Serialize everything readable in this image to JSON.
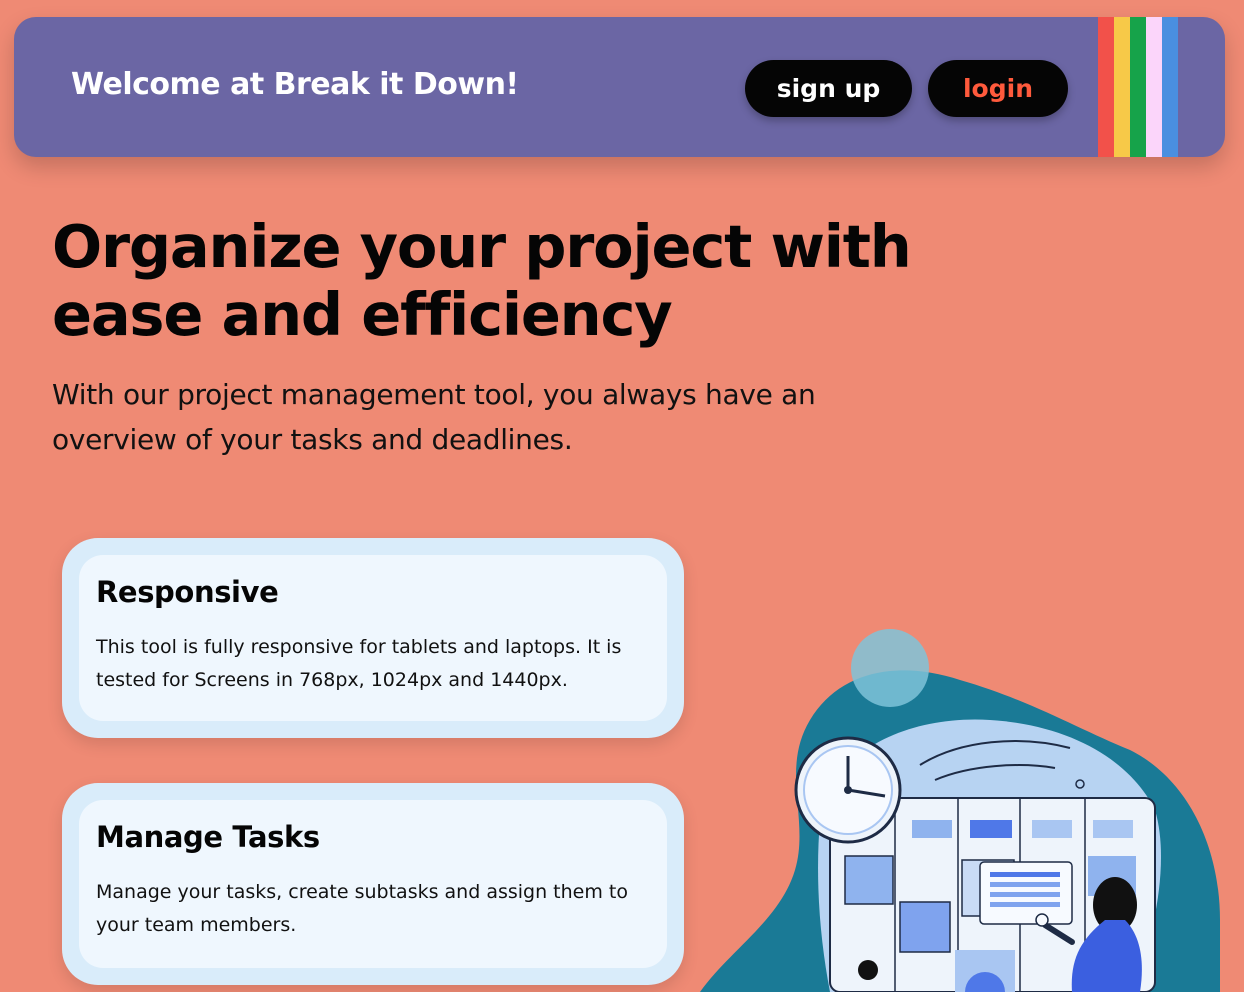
{
  "header": {
    "welcome": "Welcome at Break it Down!",
    "signup_label": "sign up",
    "login_label": "login",
    "stripe_colors": [
      "#F2514A",
      "#F7C948",
      "#16A34A",
      "#FBD5FA",
      "#4A8FE0"
    ]
  },
  "hero": {
    "title": "Organize your project with ease and efficiency",
    "subtitle": "With our project management tool, you always have an overview of your tasks and deadlines."
  },
  "features": [
    {
      "title": "Responsive",
      "text": "This tool is fully responsive for tablets and laptops. It is tested for Screens in 768px, 1024px and 1440px."
    },
    {
      "title": "Manage Tasks",
      "text": "Manage your tasks, create subtasks and assign them to your team members."
    }
  ],
  "colors": {
    "background": "#EF8A74",
    "header": "#6B66A4",
    "card_outer": "#D9ECFA",
    "card_inner": "#EFF7FE",
    "login_text": "#FF5A3C"
  },
  "illustration": {
    "icon": "kanban-board-illustration"
  }
}
